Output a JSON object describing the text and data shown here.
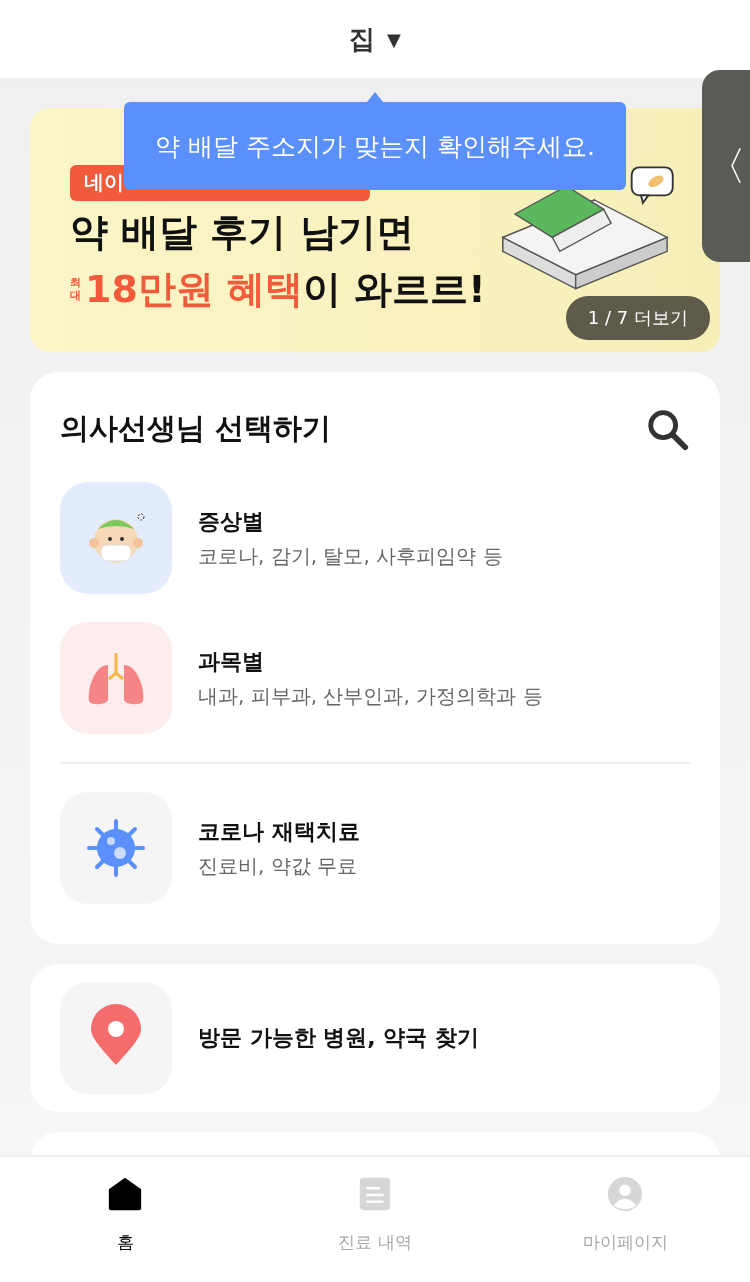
{
  "header": {
    "address": "집",
    "caret": "▼"
  },
  "tooltip": {
    "text": "약 배달 주소지가 맞는지 확인해주세요."
  },
  "banner": {
    "badge": "네이",
    "headline": "약 배달 후기 남기면",
    "prefix": "최대",
    "highlight": "18만원 혜택",
    "rest": "이 와르르!",
    "pager": "1 / 7 더보기"
  },
  "side_handle": {
    "label": "〈"
  },
  "doctor_card": {
    "title": "의사선생님 선택하기",
    "items": [
      {
        "kind": "symptom",
        "title": "증상별",
        "subtitle": "코로나, 감기, 탈모, 사후피임약 등"
      },
      {
        "kind": "department",
        "title": "과목별",
        "subtitle": "내과, 피부과, 산부인과, 가정의학과 등"
      },
      {
        "kind": "covid",
        "title": "코로나 재택치료",
        "subtitle": "진료비, 약값 무료"
      }
    ]
  },
  "finder": {
    "title": "방문 가능한 병원, 약국 찾기"
  },
  "nav": [
    {
      "kind": "home",
      "label": "홈",
      "selected": true
    },
    {
      "kind": "history",
      "label": "진료 내역",
      "selected": false
    },
    {
      "kind": "mypage",
      "label": "마이페이지",
      "selected": false
    }
  ]
}
